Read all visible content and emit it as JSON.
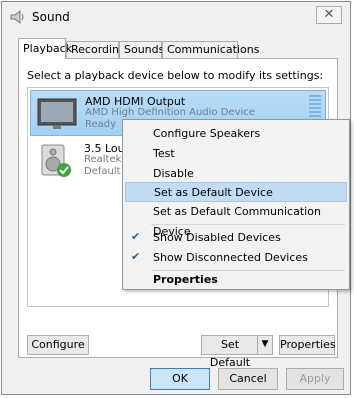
{
  "window": {
    "title": "Sound",
    "close_glyph": "✕"
  },
  "tabs": [
    {
      "label": "Playback"
    },
    {
      "label": "Recording"
    },
    {
      "label": "Sounds"
    },
    {
      "label": "Communications"
    }
  ],
  "instruction": "Select a playback device below to modify its settings:",
  "devices": [
    {
      "name": "AMD HDMI Output",
      "sub": "AMD High Definition Audio Device",
      "status": "Ready",
      "icon": "monitor-icon"
    },
    {
      "name": "3.5 Lou",
      "sub": "Realtek",
      "status": "Default",
      "icon": "speaker-icon"
    }
  ],
  "context_menu": {
    "items": [
      {
        "label": "Configure Speakers"
      },
      {
        "label": "Test"
      },
      {
        "label": "Disable"
      },
      {
        "label": "Set as Default Device"
      },
      {
        "label": "Set as Default Communication Device"
      },
      {
        "label": "Show Disabled Devices",
        "checked": true
      },
      {
        "label": "Show Disconnected Devices",
        "checked": true
      },
      {
        "label": "Properties"
      }
    ]
  },
  "panel_buttons": {
    "configure": "Configure",
    "set_default": "Set Default",
    "properties": "Properties"
  },
  "dialog_buttons": {
    "ok": "OK",
    "cancel": "Cancel",
    "apply": "Apply"
  },
  "colors": {
    "selection": "#a4d0f3",
    "menu_highlight": "#c1dcf3",
    "check": "#2d5f93"
  }
}
